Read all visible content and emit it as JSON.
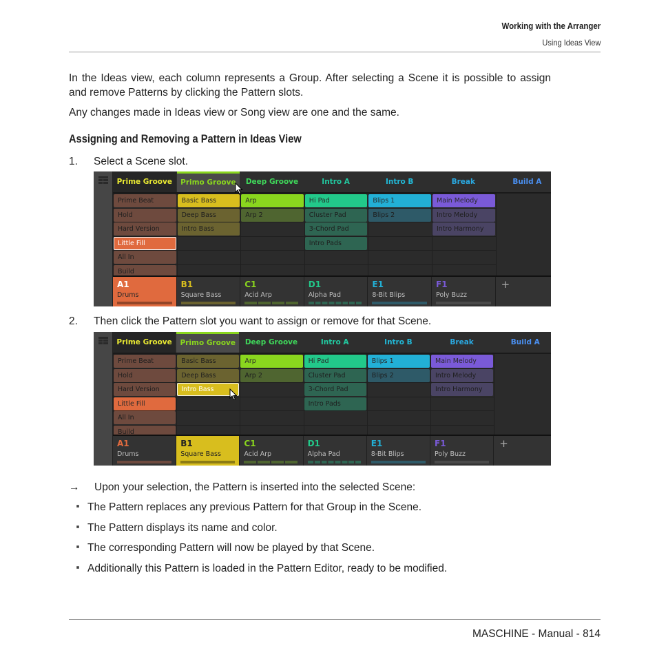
{
  "header": {
    "chapter": "Working with the Arranger",
    "section": "Using Ideas View"
  },
  "body": {
    "intro_paragraph": "In the Ideas view, each column represents a Group. After selecting a Scene it is possible to assign and remove Patterns by clicking the Pattern slots.",
    "note_paragraph": "Any changes made in Ideas view or Song view are one and the same.",
    "heading": "Assigning and Removing a Pattern in Ideas View",
    "steps": [
      {
        "num": "1.",
        "text": "Select a Scene slot."
      },
      {
        "num": "2.",
        "text": "Then click the Pattern slot you want to assign or remove for that Scene."
      }
    ],
    "result_arrow": "→",
    "result_text": "Upon your selection, the Pattern is inserted into the selected Scene:",
    "bullets": [
      "The Pattern replaces any previous Pattern for that Group in the Scene.",
      "The Pattern displays its name and color.",
      "The corresponding Pattern will now be played by that Scene.",
      "Additionally this Pattern is loaded in the Pattern Editor, ready to be modified."
    ]
  },
  "ideas_view": {
    "scenes": [
      {
        "label": "Prime Groove",
        "color": "#e8e832"
      },
      {
        "label": "Primo Groove",
        "color": "#8ad61e"
      },
      {
        "label": "Deep Groove",
        "color": "#3fd85a"
      },
      {
        "label": "Intro A",
        "color": "#22c9a0"
      },
      {
        "label": "Intro B",
        "color": "#22b8d6"
      },
      {
        "label": "Break",
        "color": "#2aa8e0"
      },
      {
        "label": "Build A",
        "color": "#4a8ff0"
      }
    ],
    "selected_scene": "Primo Groove",
    "groups": [
      {
        "id": "A1",
        "name": "Drums",
        "color": "#e06a3e",
        "cell_color": "#6e4a3e",
        "patterns": [
          "Prime Beat",
          "Hold",
          "Hard Version",
          "Little Fill",
          "All In",
          "Build"
        ]
      },
      {
        "id": "B1",
        "name": "Square Bass",
        "color": "#d8be1e",
        "cell_color": "#6b6330",
        "patterns": [
          "Basic Bass",
          "Deep Bass",
          "Intro Bass"
        ]
      },
      {
        "id": "C1",
        "name": "Acid Arp",
        "color": "#8ad61e",
        "cell_color": "#4f6530",
        "patterns": [
          "Arp",
          "Arp 2"
        ]
      },
      {
        "id": "D1",
        "name": "Alpha Pad",
        "color": "#22c98a",
        "cell_color": "#2e6552",
        "patterns": [
          "Hi Pad",
          "Cluster Pad",
          "3-Chord Pad",
          "Intro Pads"
        ]
      },
      {
        "id": "E1",
        "name": "8-Bit Blips",
        "color": "#22b0d6",
        "cell_color": "#2e5a68",
        "patterns": [
          "Blips 1",
          "Blips 2"
        ]
      },
      {
        "id": "F1",
        "name": "Poly Buzz",
        "color": "#7a5ad8",
        "cell_color": "#4a4464",
        "patterns": [
          "Main Melody",
          "Intro Melody",
          "Intro Harmony"
        ]
      }
    ],
    "add_group_label": "+",
    "screenshot1": {
      "active_patterns": {
        "A1": "Little Fill",
        "B1": "Basic Bass",
        "C1": "Arp",
        "D1": "Hi Pad",
        "E1": "Blips 1",
        "F1": "Main Melody"
      },
      "selected_group": "A1",
      "highlighted_cell": "Little Fill"
    },
    "screenshot2": {
      "active_patterns": {
        "A1": "Little Fill",
        "B1": "Intro Bass",
        "C1": "Arp",
        "D1": "Hi Pad",
        "E1": "Blips 1",
        "F1": "Main Melody"
      },
      "selected_group": "B1",
      "highlighted_cell": "Intro Bass"
    }
  },
  "footer": {
    "text": "MASCHINE - Manual - 814"
  }
}
